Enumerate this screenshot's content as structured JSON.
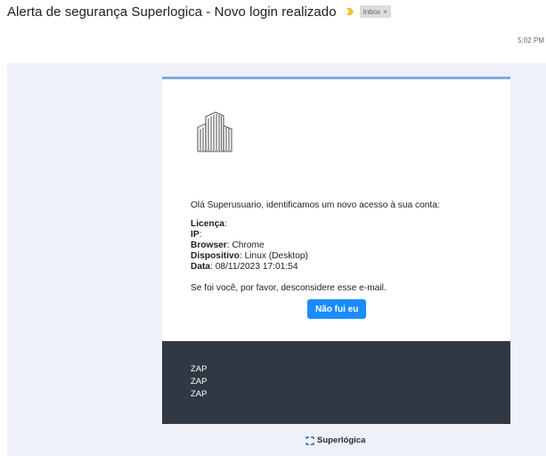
{
  "email": {
    "subject": "Alerta de segurança Superlogica - Novo login realizado",
    "label": "Inbox",
    "label_close": "×",
    "time": "5:02 PM"
  },
  "body": {
    "greeting": "Olá Superusuario, identificamos um novo acesso à sua conta:",
    "fields": [
      {
        "label": "Licença",
        "value": ""
      },
      {
        "label": "IP",
        "value": ""
      },
      {
        "label": "Browser",
        "value": "Chrome"
      },
      {
        "label": "Dispositivo",
        "value": "Linux (Desktop)"
      },
      {
        "label": "Data",
        "value": "08/11/2023 17:01:54"
      }
    ],
    "ignore_text": "Se foi você, por favor, desconsidere esse e-mail.",
    "button_label": "Não fui eu"
  },
  "footer": {
    "lines": [
      "ZAP",
      "ZAP",
      "ZAP"
    ]
  },
  "brand": {
    "name": "Superlógica"
  },
  "colors": {
    "accent_blue": "#1a8cff",
    "top_border": "#7fa8e8",
    "footer_bg": "#2f3843",
    "mail_bg": "#eef1f8",
    "importance": "#f2c12e"
  }
}
